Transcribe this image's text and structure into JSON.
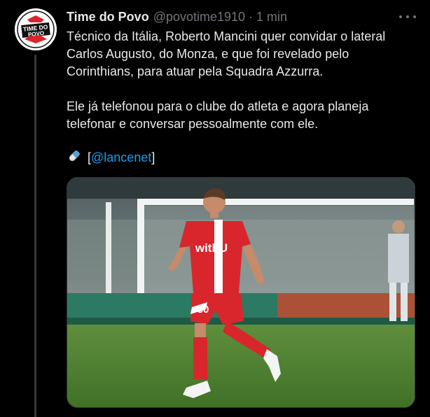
{
  "tweet": {
    "author": {
      "display_name": "Time do Povo",
      "handle": "@povotime1910",
      "avatar_text_top": "TIME DO",
      "avatar_text_bottom": "POVO"
    },
    "separator": "·",
    "time": "1 min",
    "paragraph_1": "Técnico da Itália, Roberto Mancini quer convidar o lateral Carlos Augusto, do Monza, e que foi revelado pelo Corinthians, para atuar pela Squadra Azzurra.",
    "paragraph_2": "Ele já telefonou para o clube do atleta e agora planeja telefonar e conversar pessoalmente com ele.",
    "source": {
      "bracket_open": "[",
      "mention": "@lancenet",
      "bracket_close": "]",
      "icon": "pill-icon"
    },
    "media": {
      "jersey_sponsor": "withU",
      "jersey_number": "30"
    },
    "icons": {
      "more": "more-icon",
      "avatar": "avatar-logo"
    }
  },
  "colors": {
    "background": "#000000",
    "text": "#e7e9ea",
    "secondary": "#71767b",
    "link": "#1d9bf0",
    "thread_line": "#333639",
    "jersey_red": "#d8262c"
  }
}
